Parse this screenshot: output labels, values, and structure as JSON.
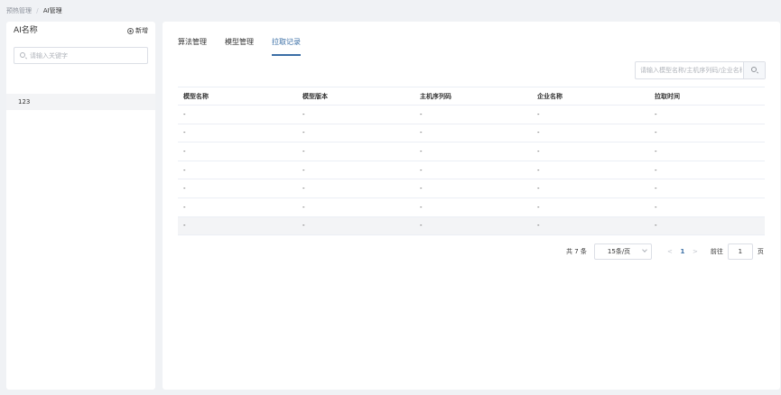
{
  "breadcrumb": {
    "parent": "预热管理",
    "separator": "/",
    "current": "AI管理"
  },
  "left_panel": {
    "title": "AI名称",
    "add_label": "新增",
    "search_placeholder": "请输入关键字",
    "items": [
      {
        "label": "123"
      }
    ]
  },
  "tabs": [
    {
      "label": "算法管理",
      "active": false
    },
    {
      "label": "模型管理",
      "active": false
    },
    {
      "label": "拉取记录",
      "active": true
    }
  ],
  "filter": {
    "placeholder": "请输入模型名称/主机序列码/企业名称"
  },
  "table": {
    "columns": [
      "模型名称",
      "模型版本",
      "主机序列码",
      "企业名称",
      "拉取时间"
    ],
    "rows": [
      [
        "-",
        "-",
        "-",
        "-",
        "-"
      ],
      [
        "-",
        "-",
        "-",
        "-",
        "-"
      ],
      [
        "-",
        "-",
        "-",
        "-",
        "-"
      ],
      [
        "-",
        "-",
        "-",
        "-",
        "-"
      ],
      [
        "-",
        "-",
        "-",
        "-",
        "-"
      ],
      [
        "-",
        "-",
        "-",
        "-",
        "-"
      ],
      [
        "-",
        "-",
        "-",
        "-",
        "-"
      ]
    ]
  },
  "pagination": {
    "total_text": "共 7 条",
    "page_size": "15条/页",
    "prev": "<",
    "current_page": "1",
    "next": ">",
    "goto_label": "前往",
    "goto_value": "1",
    "page_suffix": "页"
  },
  "colors": {
    "accent": "#3a6ea5",
    "background": "#f0f2f5"
  }
}
